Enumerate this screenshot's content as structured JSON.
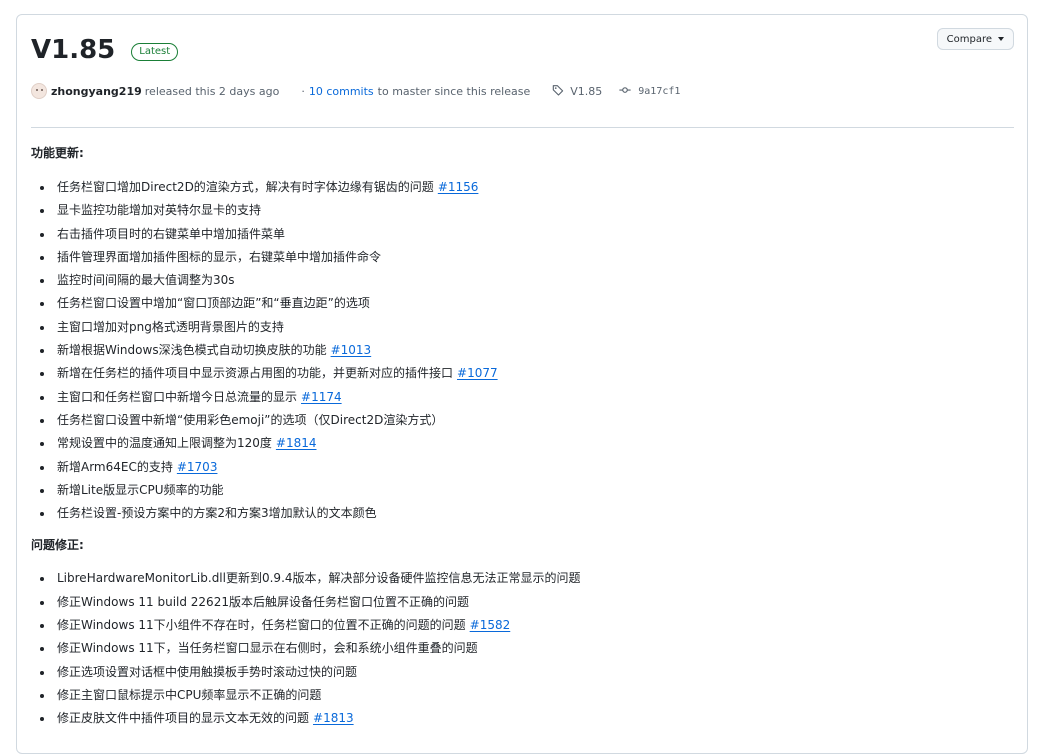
{
  "release": {
    "title": "V1.85",
    "badge": "Latest",
    "compare_label": "Compare",
    "author": "zhongyang219",
    "released_text": "released this 2 days ago",
    "commits_link": "10 commits",
    "commits_suffix": "to master since this release",
    "tag": "V1.85",
    "commit_hash": "9a17cf1"
  },
  "sections": [
    {
      "heading": "功能更新:",
      "items": [
        {
          "text": "任务栏窗口增加Direct2D的渲染方式，解决有时字体边缘有锯齿的问题",
          "issue": "#1156"
        },
        {
          "text": "显卡监控功能增加对英特尔显卡的支持",
          "issue": ""
        },
        {
          "text": "右击插件项目时的右键菜单中增加插件菜单",
          "issue": ""
        },
        {
          "text": "插件管理界面增加插件图标的显示，右键菜单中增加插件命令",
          "issue": ""
        },
        {
          "text": "监控时间间隔的最大值调整为30s",
          "issue": ""
        },
        {
          "text": "任务栏窗口设置中增加“窗口顶部边距”和“垂直边距”的选项",
          "issue": ""
        },
        {
          "text": "主窗口增加对png格式透明背景图片的支持",
          "issue": ""
        },
        {
          "text": "新增根据Windows深浅色模式自动切换皮肤的功能",
          "issue": "#1013"
        },
        {
          "text": "新增在任务栏的插件项目中显示资源占用图的功能，并更新对应的插件接口",
          "issue": "#1077"
        },
        {
          "text": "主窗口和任务栏窗口中新增今日总流量的显示",
          "issue": "#1174"
        },
        {
          "text": "任务栏窗口设置中新增“使用彩色emoji”的选项（仅Direct2D渲染方式）",
          "issue": ""
        },
        {
          "text": "常规设置中的温度通知上限调整为120度",
          "issue": "#1814"
        },
        {
          "text": "新增Arm64EC的支持",
          "issue": "#1703"
        },
        {
          "text": "新增Lite版显示CPU频率的功能",
          "issue": ""
        },
        {
          "text": "任务栏设置-预设方案中的方案2和方案3增加默认的文本颜色",
          "issue": ""
        }
      ]
    },
    {
      "heading": "问题修正:",
      "items": [
        {
          "text": "LibreHardwareMonitorLib.dll更新到0.9.4版本，解决部分设备硬件监控信息无法正常显示的问题",
          "issue": ""
        },
        {
          "text": "修正Windows 11 build 22621版本后触屏设备任务栏窗口位置不正确的问题",
          "issue": ""
        },
        {
          "text": "修正Windows 11下小组件不存在时，任务栏窗口的位置不正确的问题的问题",
          "issue": "#1582"
        },
        {
          "text": "修正Windows 11下，当任务栏窗口显示在右侧时，会和系统小组件重叠的问题",
          "issue": ""
        },
        {
          "text": "修正选项设置对话框中使用触摸板手势时滚动过快的问题",
          "issue": ""
        },
        {
          "text": "修正主窗口鼠标提示中CPU频率显示不正确的问题",
          "issue": ""
        },
        {
          "text": "修正皮肤文件中插件项目的显示文本无效的问题",
          "issue": "#1813"
        }
      ]
    }
  ],
  "colors": {
    "link": "#0969da",
    "badge": "#1a7f37",
    "border": "#d1d9e0",
    "text": "#1f2328",
    "muted": "#59636e"
  },
  "icons": {
    "tag": "tag-icon",
    "commit": "git-commit-icon",
    "caret": "triangle-down-icon"
  }
}
